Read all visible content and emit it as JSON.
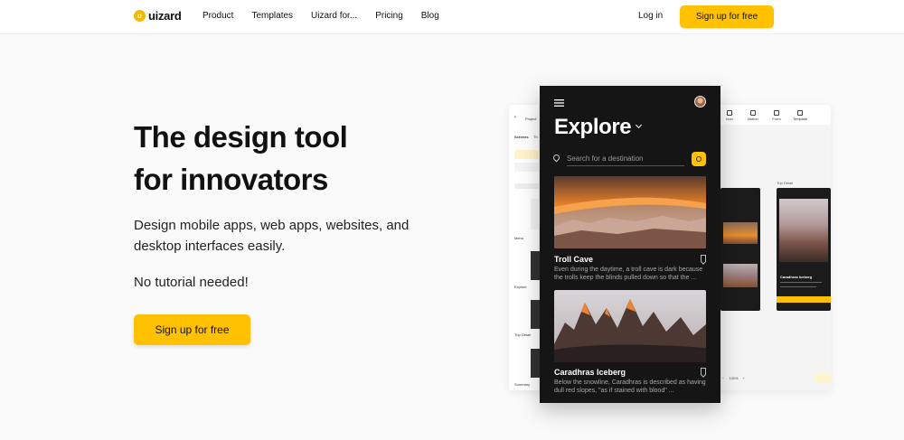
{
  "brand": {
    "name": "uizard",
    "mark": "u"
  },
  "nav": {
    "links": [
      "Product",
      "Templates",
      "Uizard for...",
      "Pricing",
      "Blog"
    ],
    "login": "Log in",
    "cta": "Sign up for free"
  },
  "hero": {
    "title_line1": "The design tool",
    "title_line2": "for innovators",
    "subtitle": "Design mobile apps, web apps, websites, and desktop interfaces easily.",
    "note": "No tutorial needed!",
    "cta": "Sign up for free"
  },
  "mockup": {
    "editor": {
      "back_label": "Project",
      "tabs": [
        "Screens",
        "Th"
      ],
      "screen_labels": [
        "Menu",
        "Explore",
        "Trip Detail",
        "Summary"
      ],
      "tools": [
        "Icon",
        "Button",
        "Form",
        "Template"
      ],
      "canvas_label": "Trip Detail",
      "mini_title": "Caradhras Iceberg",
      "zoom": "100%"
    },
    "phone": {
      "heading": "Explore",
      "search_placeholder": "Search for a destination",
      "cards": [
        {
          "title": "Troll Cave",
          "description": "Even during the daytime, a troll cave is dark because the trolls keep the blinds pulled down so that the ..."
        },
        {
          "title": "Caradhras Iceberg",
          "description": "Below the snowline, Caradhras is described as having dull red slopes, \"as if stained with blood\" ..."
        }
      ]
    }
  },
  "colors": {
    "accent": "#ffc100",
    "phone_bg": "#151515"
  }
}
